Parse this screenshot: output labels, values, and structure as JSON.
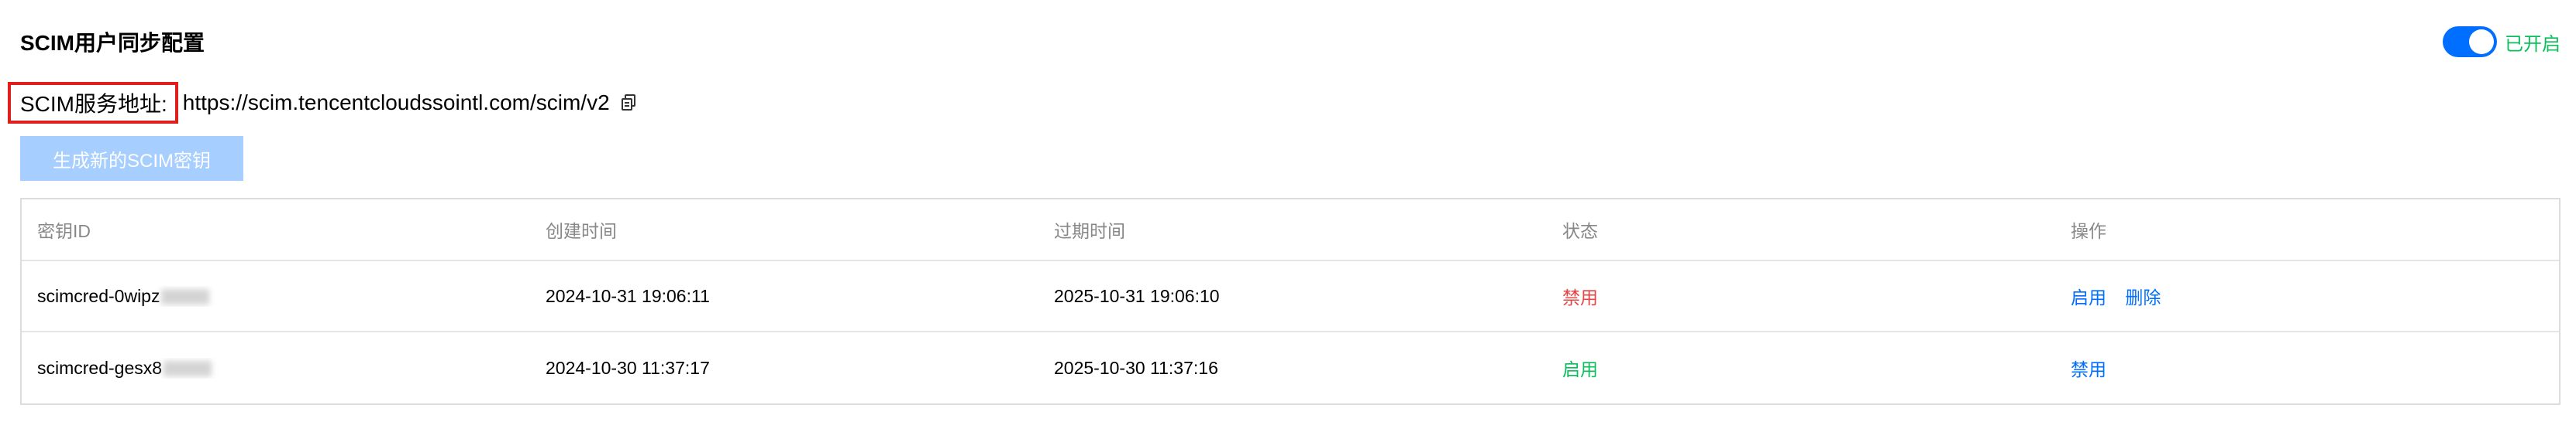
{
  "page": {
    "title": "SCIM用户同步配置",
    "toggle": {
      "state": "on",
      "label": "已开启",
      "color": "#006eff",
      "label_color": "#0abf5b"
    }
  },
  "service": {
    "label": "SCIM服务地址:",
    "url": "https://scim.tencentcloudssointl.com/scim/v2",
    "copy_icon": "copy-icon"
  },
  "generate_button": {
    "label": "生成新的SCIM密钥",
    "disabled": true,
    "color": "#a6ceff"
  },
  "table": {
    "headers": [
      "密钥ID",
      "创建时间",
      "过期时间",
      "状态",
      "操作"
    ],
    "rows": [
      {
        "key_id": "scimcred-0wipz",
        "created": "2024-10-31 19:06:11",
        "expires": "2025-10-31 19:06:10",
        "status": "禁用",
        "status_color": "#e54545",
        "actions": [
          "启用",
          "删除"
        ]
      },
      {
        "key_id": "scimcred-gesx8",
        "created": "2024-10-30 11:37:17",
        "expires": "2025-10-30 11:37:16",
        "status": "启用",
        "status_color": "#0abf5b",
        "actions": [
          "禁用"
        ]
      }
    ]
  },
  "colors": {
    "link": "#006eff",
    "highlight_border": "#e01e1e"
  }
}
